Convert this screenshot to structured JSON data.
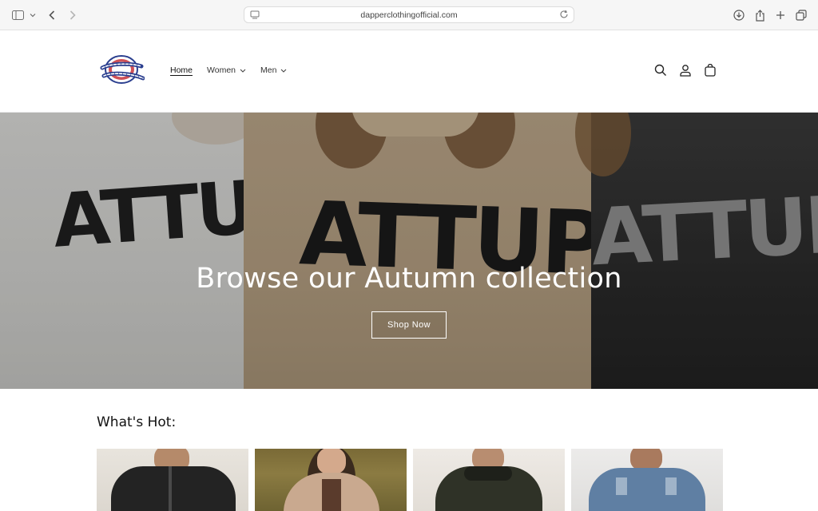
{
  "browser": {
    "url": "dapperclothingofficial.com"
  },
  "store": {
    "logo_text": "Dapper Clothing",
    "nav": [
      {
        "label": "Home",
        "active": true,
        "dropdown": false
      },
      {
        "label": "Women",
        "active": false,
        "dropdown": true
      },
      {
        "label": "Men",
        "active": false,
        "dropdown": true
      }
    ],
    "icons": [
      "search-icon",
      "account-icon",
      "cart-icon"
    ]
  },
  "hero": {
    "title": "Browse our Autumn collection",
    "button_label": "Shop Now",
    "sweater_text": "ATTUPE"
  },
  "hot": {
    "title": "What's Hot:"
  },
  "colors": {
    "text": "#121212",
    "hero_white": "#ffffff",
    "logo_blue": "#2b3f8f",
    "logo_red": "#c8323a"
  }
}
